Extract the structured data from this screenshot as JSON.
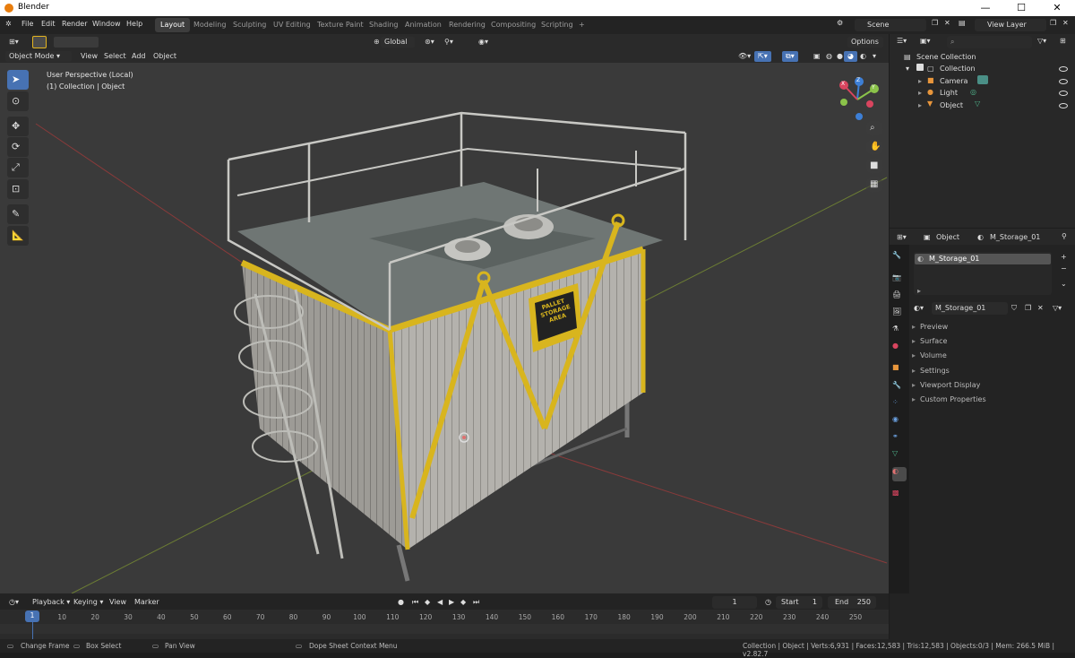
{
  "window": {
    "title": "Blender",
    "minimize": "—",
    "maximize": "☐",
    "close": "✕"
  },
  "menus": [
    "File",
    "Edit",
    "Render",
    "Window",
    "Help"
  ],
  "workspaces": [
    {
      "label": "Layout",
      "active": true
    },
    {
      "label": "Modeling"
    },
    {
      "label": "Sculpting"
    },
    {
      "label": "UV Editing"
    },
    {
      "label": "Texture Paint"
    },
    {
      "label": "Shading"
    },
    {
      "label": "Animation"
    },
    {
      "label": "Rendering"
    },
    {
      "label": "Compositing"
    },
    {
      "label": "Scripting"
    }
  ],
  "add_workspace": "+",
  "scene": {
    "label": "Scene"
  },
  "view_layer": {
    "label": "View Layer"
  },
  "viewport": {
    "transform_orientation": "Global",
    "options_label": "Options",
    "mode": "Object Mode",
    "header_menus": [
      "View",
      "Select",
      "Add",
      "Object"
    ],
    "overlay_line1": "User Perspective (Local)",
    "overlay_line2": "(1) Collection | Object",
    "sign_text": [
      "PALLET",
      "STORAGE",
      "AREA"
    ],
    "gizmo": {
      "z": "Z",
      "y": "Y",
      "x": "X"
    }
  },
  "outliner": {
    "search_placeholder": "",
    "root": "Scene Collection",
    "items": [
      {
        "label": "Collection",
        "level": 1
      },
      {
        "label": "Camera",
        "level": 2
      },
      {
        "label": "Light",
        "level": 2
      },
      {
        "label": "Object",
        "level": 2
      }
    ]
  },
  "properties": {
    "context": "Object",
    "material_name": "M_Storage_01",
    "slot": "M_Storage_01",
    "material_field": "M_Storage_01",
    "panels": [
      "Preview",
      "Surface",
      "Volume",
      "Settings",
      "Viewport Display",
      "Custom Properties"
    ]
  },
  "timeline": {
    "menus": [
      "Playback",
      "Keying",
      "View",
      "Marker"
    ],
    "current_frame": "1",
    "start_label": "Start",
    "start": "1",
    "end_label": "End",
    "end": "250",
    "ticks": [
      "1",
      "10",
      "20",
      "30",
      "40",
      "50",
      "60",
      "70",
      "80",
      "90",
      "100",
      "110",
      "120",
      "130",
      "140",
      "150",
      "160",
      "170",
      "180",
      "190",
      "200",
      "210",
      "220",
      "230",
      "240",
      "250"
    ]
  },
  "status": {
    "change_frame": "Change Frame",
    "box_select": "Box Select",
    "pan_view": "Pan View",
    "context_menu": "Dope Sheet Context Menu",
    "stats": "Collection | Object | Verts:6,931 | Faces:12,583 | Tris:12,583 | Objects:0/3 | Mem: 266.5 MiB | v2.82.7"
  },
  "colors": {
    "accent": "#4772b3",
    "yellow": "#d8b51e",
    "header": "#232323"
  }
}
